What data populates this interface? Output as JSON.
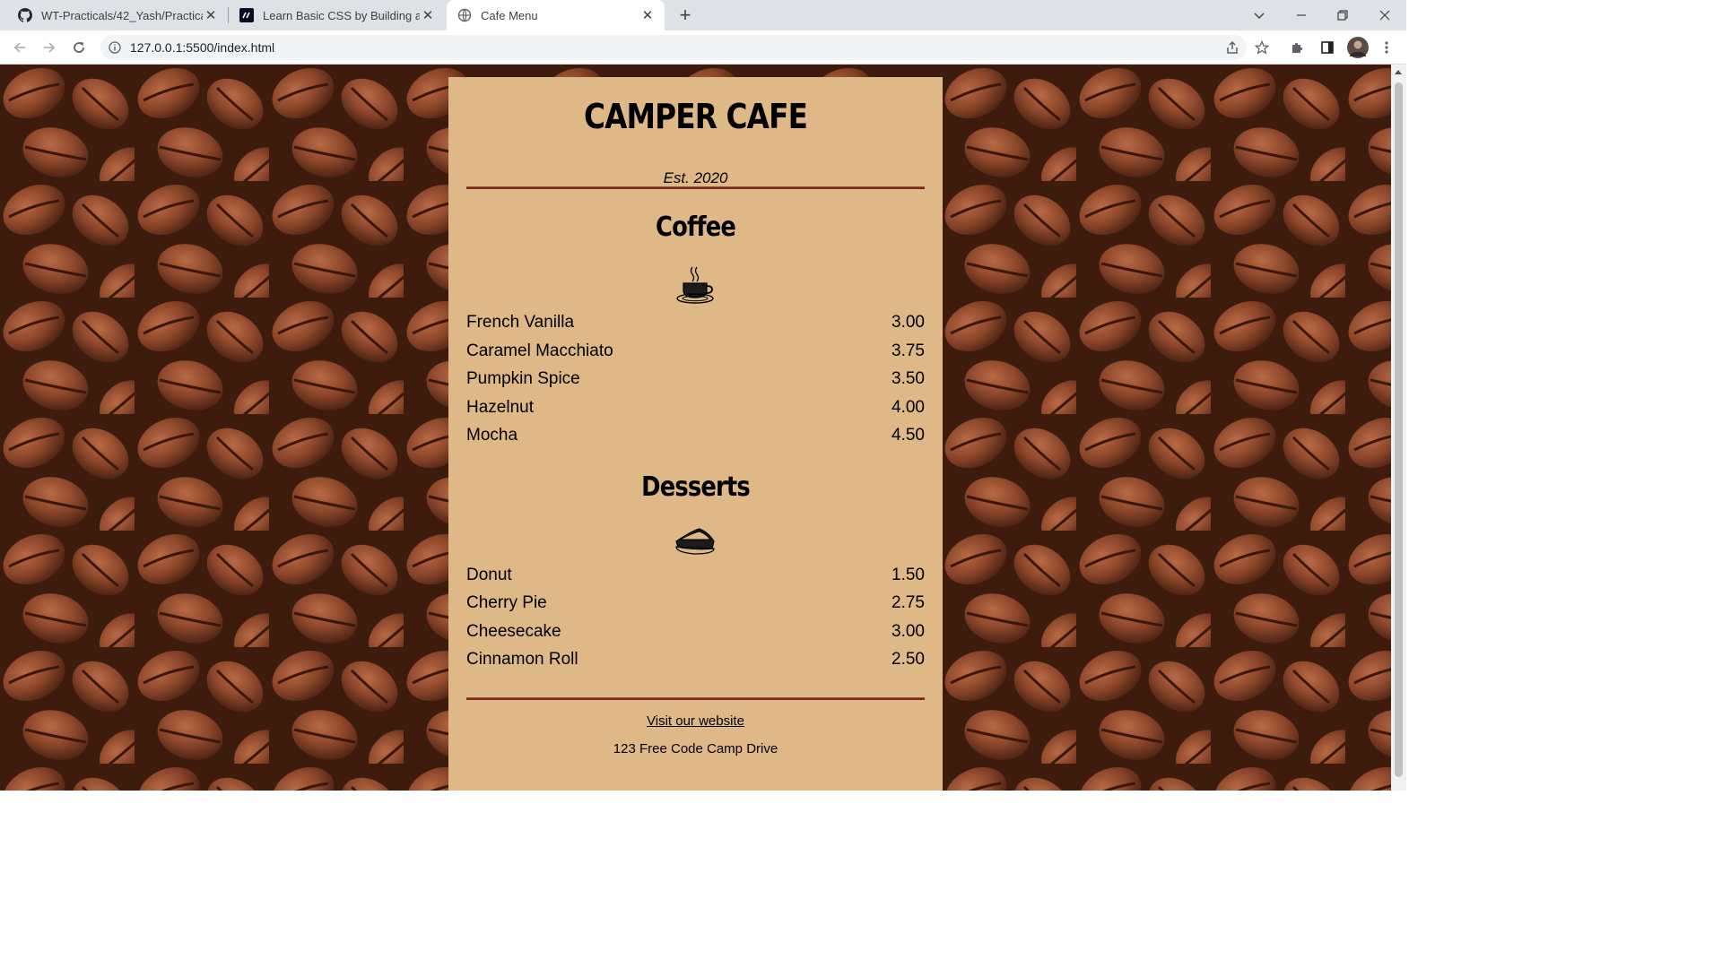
{
  "browser": {
    "tabs": [
      {
        "title": "WT-Practicals/42_Yash/Practical_",
        "icon": "github-icon"
      },
      {
        "title": "Learn Basic CSS by Building a Caf",
        "icon": "freecodecamp-icon"
      },
      {
        "title": "Cafe Menu",
        "icon": "globe-icon"
      }
    ],
    "url": "127.0.0.1:5500/index.html"
  },
  "menu": {
    "title": "CAMPER CAFE",
    "established": "Est. 2020",
    "sections": [
      {
        "heading": "Coffee",
        "icon": "coffee-cup-icon",
        "items": [
          {
            "name": "French Vanilla",
            "price": "3.00"
          },
          {
            "name": "Caramel Macchiato",
            "price": "3.75"
          },
          {
            "name": "Pumpkin Spice",
            "price": "3.50"
          },
          {
            "name": "Hazelnut",
            "price": "4.00"
          },
          {
            "name": "Mocha",
            "price": "4.50"
          }
        ]
      },
      {
        "heading": "Desserts",
        "icon": "pie-slice-icon",
        "items": [
          {
            "name": "Donut",
            "price": "1.50"
          },
          {
            "name": "Cherry Pie",
            "price": "2.75"
          },
          {
            "name": "Cheesecake",
            "price": "3.00"
          },
          {
            "name": "Cinnamon Roll",
            "price": "2.50"
          }
        ]
      }
    ],
    "footer": {
      "link_text": "Visit our website",
      "address": "123 Free Code Camp Drive"
    }
  },
  "colors": {
    "card_background": "#deb887",
    "divider": "#792a1f"
  }
}
